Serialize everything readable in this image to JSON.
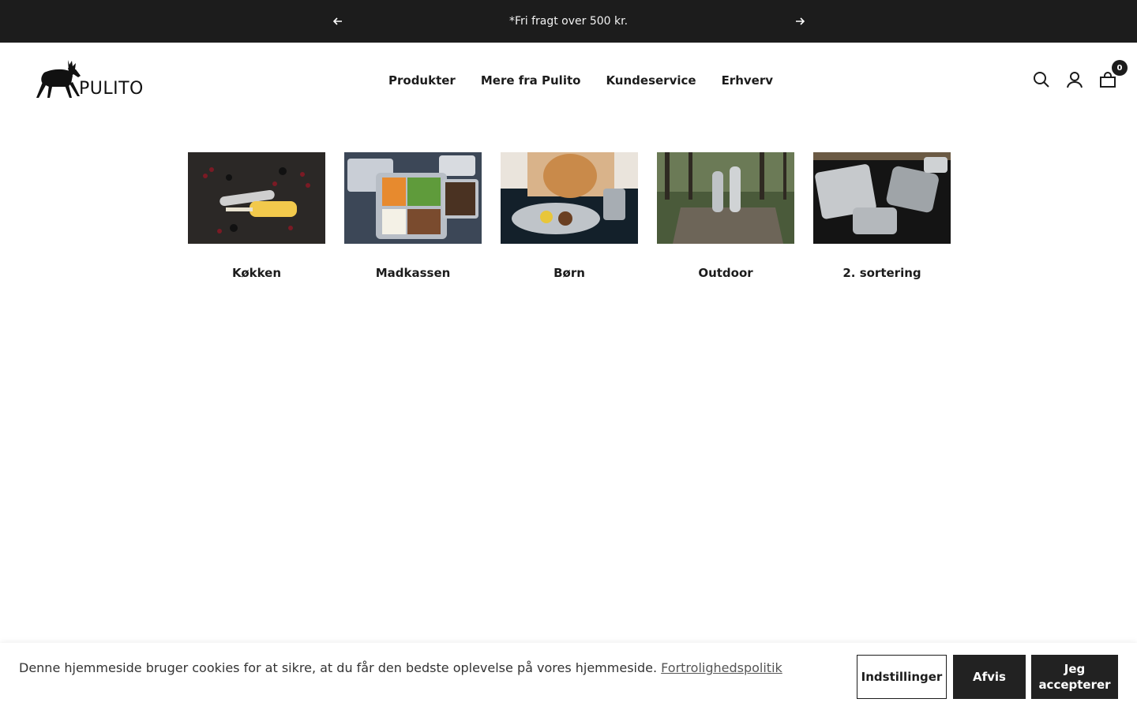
{
  "announcement": {
    "message": "*Fri fragt over 500 kr.",
    "prev_icon": "arrow-left-icon",
    "next_icon": "arrow-right-icon"
  },
  "header": {
    "logo_text": "PULITO",
    "logo_icon": "moose-icon",
    "nav": [
      {
        "label": "Produkter"
      },
      {
        "label": "Mere fra Pulito"
      },
      {
        "label": "Kundeservice"
      },
      {
        "label": "Erhverv"
      }
    ],
    "icons": [
      "search-icon",
      "account-icon",
      "cart-icon"
    ],
    "cart_count": "0"
  },
  "collections": [
    {
      "title": "Køkken"
    },
    {
      "title": "Madkassen"
    },
    {
      "title": "Børn"
    },
    {
      "title": "Outdoor"
    },
    {
      "title": "2. sortering"
    }
  ],
  "cookie_banner": {
    "text": "Denne hjemmeside bruger cookies for at sikre, at du får den bedste oplevelse på vores hjemmeside.",
    "link": "Fortrolighedspolitik",
    "settings_label": "Indstillinger",
    "reject_label": "Afvis",
    "accept_label": "Jeg accepterer"
  },
  "colors": {
    "announcement_bg": "#1c1c1c",
    "text": "#1c1c1c",
    "button_dark": "#222222"
  }
}
